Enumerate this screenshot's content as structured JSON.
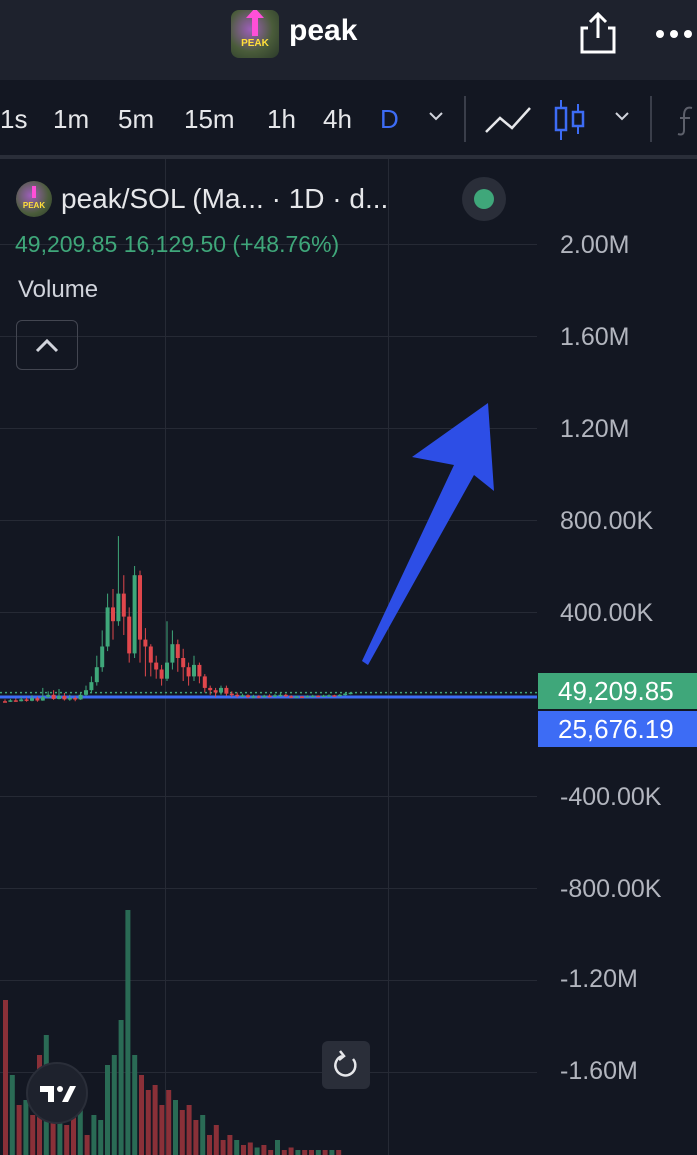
{
  "header": {
    "app_title": "peak",
    "logo_text": "PEAK",
    "share_icon": "share-icon",
    "more_icon": "more-icon"
  },
  "toolbar": {
    "timeframes": [
      {
        "label": "1s",
        "active": false
      },
      {
        "label": "1m",
        "active": false
      },
      {
        "label": "5m",
        "active": false
      },
      {
        "label": "15m",
        "active": false
      },
      {
        "label": "1h",
        "active": false
      },
      {
        "label": "4h",
        "active": false
      },
      {
        "label": "D",
        "active": true
      }
    ],
    "timeframe_dropdown_icon": "chevron-down-icon",
    "line_chart_icon": "line-chart-icon",
    "candle_chart_icon": "candlestick-icon",
    "chart_type_dropdown_icon": "chevron-down-icon",
    "indicator_icon": "indicator-icon"
  },
  "legend": {
    "symbol": "peak/SOL (Ma... · 1D · d...",
    "symbol_icon_text": "PEAK",
    "ohlc": "49,209.85  16,129.50 (+48.76%)",
    "volume_label": "Volume",
    "status": "market-open"
  },
  "price_scale": {
    "labels": [
      "2.00M",
      "1.60M",
      "1.20M",
      "800.00K",
      "400.00K",
      "-400.00K",
      "-800.00K",
      "-1.20M",
      "-1.60M"
    ],
    "last_price": "49,209.85",
    "second_price": "25,676.19"
  },
  "colors": {
    "up": "#3fa77a",
    "down": "#e0474c",
    "accent": "#3d6cf5",
    "background": "#131722"
  },
  "candles": [
    [
      1,
      12000,
      10000,
      20000,
      8000
    ],
    [
      2,
      10000,
      16000,
      22000,
      9000
    ],
    [
      3,
      16000,
      12000,
      24000,
      10000
    ],
    [
      4,
      12000,
      20000,
      30000,
      11000
    ],
    [
      5,
      20000,
      14000,
      28000,
      10000
    ],
    [
      6,
      14000,
      25000,
      38000,
      12000
    ],
    [
      7,
      25000,
      15000,
      32000,
      10000
    ],
    [
      8,
      15000,
      30000,
      70000,
      14000
    ],
    [
      9,
      30000,
      40000,
      55000,
      25000
    ],
    [
      10,
      40000,
      22000,
      60000,
      18000
    ],
    [
      11,
      22000,
      35000,
      65000,
      20000
    ],
    [
      12,
      35000,
      20000,
      48000,
      15000
    ],
    [
      13,
      20000,
      26000,
      40000,
      14000
    ],
    [
      14,
      26000,
      20000,
      35000,
      12000
    ],
    [
      15,
      20000,
      40000,
      52000,
      18000
    ],
    [
      16,
      40000,
      60000,
      80000,
      35000
    ],
    [
      17,
      60000,
      95000,
      120000,
      50000
    ],
    [
      18,
      95000,
      160000,
      210000,
      80000
    ],
    [
      19,
      160000,
      250000,
      320000,
      140000
    ],
    [
      20,
      250000,
      420000,
      480000,
      230000
    ],
    [
      21,
      420000,
      360000,
      500000,
      280000
    ],
    [
      22,
      360000,
      480000,
      730000,
      340000
    ],
    [
      23,
      480000,
      380000,
      560000,
      300000
    ],
    [
      24,
      380000,
      220000,
      420000,
      180000
    ],
    [
      25,
      220000,
      560000,
      600000,
      200000
    ],
    [
      26,
      560000,
      280000,
      580000,
      180000
    ],
    [
      27,
      280000,
      250000,
      330000,
      120000
    ],
    [
      28,
      250000,
      180000,
      260000,
      120000
    ],
    [
      29,
      180000,
      150000,
      210000,
      110000
    ],
    [
      30,
      150000,
      110000,
      170000,
      80000
    ],
    [
      31,
      110000,
      180000,
      360000,
      100000
    ],
    [
      32,
      180000,
      260000,
      320000,
      150000
    ],
    [
      33,
      260000,
      200000,
      280000,
      140000
    ],
    [
      34,
      200000,
      160000,
      240000,
      100000
    ],
    [
      35,
      160000,
      120000,
      180000,
      80000
    ],
    [
      36,
      120000,
      170000,
      210000,
      100000
    ],
    [
      37,
      170000,
      120000,
      180000,
      90000
    ],
    [
      38,
      120000,
      70000,
      130000,
      50000
    ],
    [
      39,
      70000,
      60000,
      80000,
      40000
    ],
    [
      40,
      60000,
      50000,
      70000,
      30000
    ],
    [
      41,
      50000,
      70000,
      80000,
      40000
    ],
    [
      42,
      70000,
      45000,
      80000,
      35000
    ],
    [
      43,
      45000,
      40000,
      55000,
      30000
    ],
    [
      44,
      40000,
      35000,
      50000,
      28000
    ],
    [
      45,
      35000,
      38000,
      45000,
      30000
    ],
    [
      46,
      38000,
      30000,
      42000,
      25000
    ],
    [
      47,
      30000,
      34000,
      40000,
      24000
    ],
    [
      48,
      34000,
      30000,
      38000,
      25000
    ],
    [
      49,
      30000,
      36000,
      40000,
      28000
    ],
    [
      50,
      36000,
      32000,
      42000,
      28000
    ],
    [
      51,
      32000,
      38000,
      44000,
      30000
    ],
    [
      52,
      38000,
      40000,
      50000,
      32000
    ],
    [
      53,
      40000,
      34000,
      44000,
      30000
    ],
    [
      54,
      34000,
      30000,
      38000,
      26000
    ],
    [
      55,
      30000,
      33000,
      36000,
      27000
    ],
    [
      56,
      33000,
      31000,
      35000,
      28000
    ],
    [
      57,
      31000,
      35000,
      38000,
      29000
    ],
    [
      58,
      35000,
      36000,
      40000,
      31000
    ],
    [
      59,
      36000,
      34000,
      38000,
      30000
    ],
    [
      60,
      34000,
      37000,
      40000,
      31000
    ],
    [
      61,
      37000,
      38000,
      42000,
      33000
    ],
    [
      62,
      38000,
      36000,
      40000,
      33000
    ],
    [
      63,
      36000,
      40000,
      43000,
      34000
    ],
    [
      64,
      40000,
      45000,
      48000,
      37000
    ],
    [
      65,
      45000,
      49209,
      52000,
      42000
    ]
  ],
  "volumes": [
    [
      1,
      0.62,
      0
    ],
    [
      2,
      0.32,
      1
    ],
    [
      3,
      0.2,
      0
    ],
    [
      4,
      0.22,
      1
    ],
    [
      5,
      0.16,
      0
    ],
    [
      6,
      0.4,
      0
    ],
    [
      7,
      0.48,
      1
    ],
    [
      8,
      0.24,
      0
    ],
    [
      9,
      0.28,
      1
    ],
    [
      10,
      0.12,
      0
    ],
    [
      11,
      0.18,
      0
    ],
    [
      12,
      0.22,
      1
    ],
    [
      13,
      0.08,
      0
    ],
    [
      14,
      0.16,
      1
    ],
    [
      15,
      0.14,
      1
    ],
    [
      16,
      0.36,
      1
    ],
    [
      17,
      0.4,
      1
    ],
    [
      18,
      0.54,
      1
    ],
    [
      19,
      0.98,
      1
    ],
    [
      20,
      0.4,
      1
    ],
    [
      21,
      0.32,
      0
    ],
    [
      22,
      0.26,
      0
    ],
    [
      23,
      0.28,
      0
    ],
    [
      24,
      0.2,
      0
    ],
    [
      25,
      0.26,
      0
    ],
    [
      26,
      0.22,
      1
    ],
    [
      27,
      0.18,
      0
    ],
    [
      28,
      0.2,
      0
    ],
    [
      29,
      0.14,
      0
    ],
    [
      30,
      0.16,
      1
    ],
    [
      31,
      0.08,
      0
    ],
    [
      32,
      0.12,
      0
    ],
    [
      33,
      0.06,
      0
    ],
    [
      34,
      0.08,
      0
    ],
    [
      35,
      0.06,
      1
    ],
    [
      36,
      0.04,
      0
    ],
    [
      37,
      0.05,
      0
    ],
    [
      38,
      0.03,
      1
    ],
    [
      39,
      0.04,
      0
    ],
    [
      40,
      0.02,
      0
    ],
    [
      41,
      0.06,
      1
    ],
    [
      42,
      0.02,
      0
    ],
    [
      43,
      0.03,
      0
    ],
    [
      44,
      0.02,
      1
    ],
    [
      45,
      0.02,
      0
    ],
    [
      46,
      0.02,
      0
    ],
    [
      47,
      0.02,
      1
    ],
    [
      48,
      0.02,
      0
    ],
    [
      49,
      0.02,
      1
    ],
    [
      50,
      0.02,
      0
    ]
  ]
}
